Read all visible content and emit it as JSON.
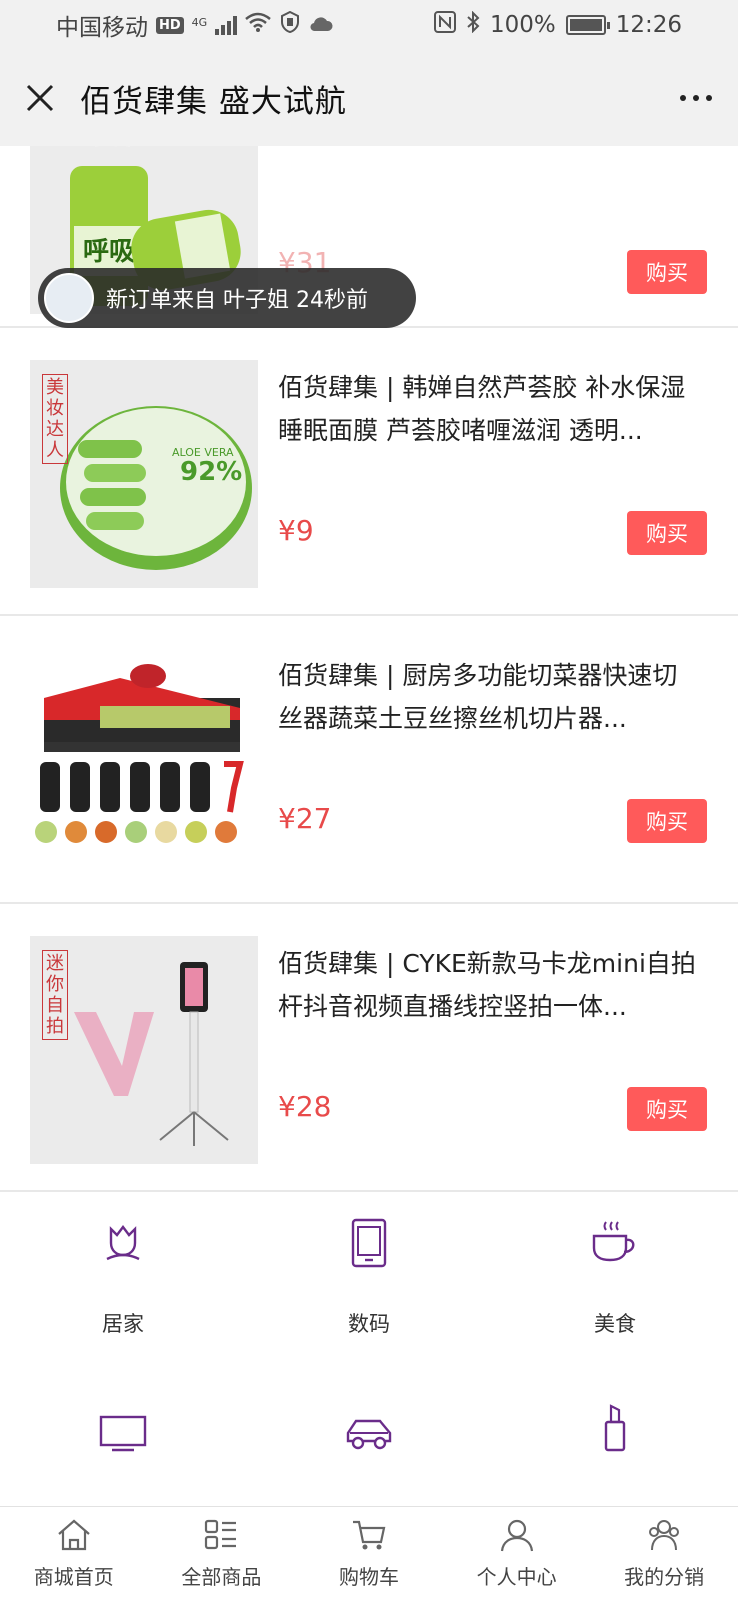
{
  "status_bar": {
    "carrier": "中国移动",
    "hd_badge": "HD",
    "network": "4G",
    "battery": "100%",
    "time": "12:26"
  },
  "header": {
    "title": "佰货肆集 盛大试航"
  },
  "toast": {
    "text": "新订单来自 叶子姐 24秒前"
  },
  "products": [
    {
      "title": "",
      "price": "¥31",
      "buy_label": "购买",
      "tag": ""
    },
    {
      "title": "佰货肆集 | 韩婵自然芦荟胶 补水保湿睡眠面膜 芦荟胶啫喱滋润 透明...",
      "price": "¥9",
      "buy_label": "购买",
      "tag": "美妆达人"
    },
    {
      "title": "佰货肆集 | 厨房多功能切菜器快速切丝器蔬菜土豆丝擦丝机切片器...",
      "price": "¥27",
      "buy_label": "购买",
      "tag": ""
    },
    {
      "title": "佰货肆集 | CYKE新款马卡龙mini自拍杆抖音视频直播线控竖拍一体...",
      "price": "¥28",
      "buy_label": "购买",
      "tag": "迷你自拍"
    }
  ],
  "categories": [
    {
      "label": "居家",
      "icon": "flower-icon"
    },
    {
      "label": "数码",
      "icon": "tablet-icon"
    },
    {
      "label": "美食",
      "icon": "coffee-cup-icon"
    },
    {
      "label": "",
      "icon": "tv-icon"
    },
    {
      "label": "",
      "icon": "car-icon"
    },
    {
      "label": "",
      "icon": "lipstick-icon"
    }
  ],
  "tabs": [
    {
      "label": "商城首页",
      "icon": "home-icon"
    },
    {
      "label": "全部商品",
      "icon": "grid-list-icon"
    },
    {
      "label": "购物车",
      "icon": "cart-icon"
    },
    {
      "label": "个人中心",
      "icon": "user-icon"
    },
    {
      "label": "我的分销",
      "icon": "users-icon"
    }
  ],
  "colors": {
    "accent_red": "#ff5a5a",
    "price_red": "#e84a4a",
    "category_purple": "#6a2c8a"
  }
}
